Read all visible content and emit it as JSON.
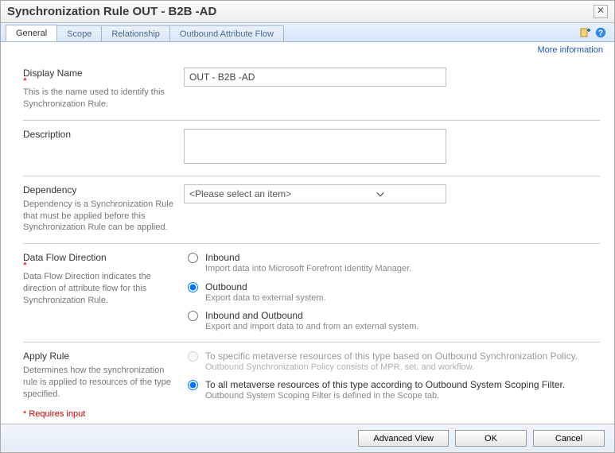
{
  "window": {
    "title": "Synchronization Rule OUT - B2B -AD"
  },
  "tabs": {
    "t0": "General",
    "t1": "Scope",
    "t2": "Relationship",
    "t3": "Outbound Attribute Flow"
  },
  "more_info": "More information",
  "fields": {
    "display_name": {
      "label": "Display Name",
      "hint": "This is the name used to identify this Synchronization Rule.",
      "value": "OUT - B2B -AD"
    },
    "description": {
      "label": "Description",
      "value": ""
    },
    "dependency": {
      "label": "Dependency",
      "hint": "Dependency is a Synchronization Rule that must be applied before this Synchronization Rule can be applied.",
      "placeholder": "<Please select an item>"
    },
    "flow": {
      "label": "Data Flow Direction",
      "hint": "Data Flow Direction indicates the direction of attribute flow for this Synchronization Rule.",
      "opt_in": {
        "main": "Inbound",
        "sub": "Import data into Microsoft Forefront Identity Manager."
      },
      "opt_out": {
        "main": "Outbound",
        "sub": "Export data to external system."
      },
      "opt_io": {
        "main": "Inbound and Outbound",
        "sub": "Export and import data to and from an external system."
      }
    },
    "apply": {
      "label": "Apply Rule",
      "hint": "Determines how the synchronization rule is applied to resources of the type specified.",
      "opt_policy": {
        "main": "To specific metaverse resources of this type based on Outbound Synchronization Policy.",
        "sub": "Outbound Synchronization Policy consists of MPR, set, and workflow."
      },
      "opt_filter": {
        "main": "To all metaverse resources of this type according to Outbound System Scoping Filter.",
        "sub": "Outbound System Scoping Filter is defined in the Scope tab."
      }
    }
  },
  "requires_note": "* Requires input",
  "buttons": {
    "advanced": "Advanced View",
    "ok": "OK",
    "cancel": "Cancel"
  }
}
